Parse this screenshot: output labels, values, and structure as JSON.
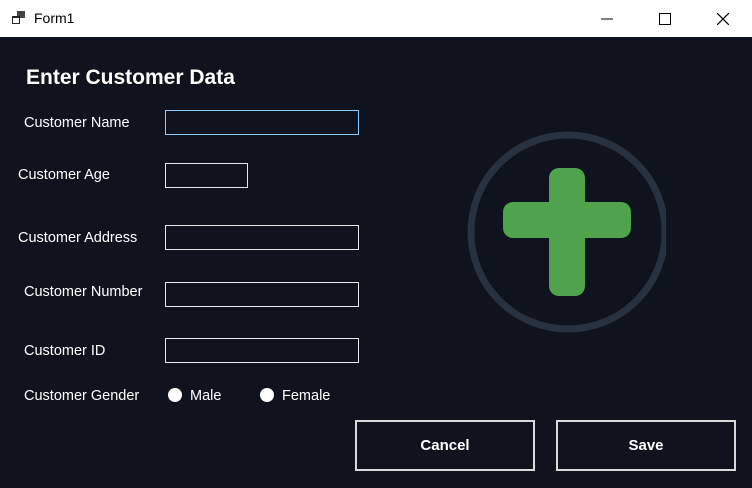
{
  "window": {
    "title": "Form1",
    "icons": {
      "app": "app-icon",
      "minimize": "minimize-icon",
      "maximize": "maximize-icon",
      "close": "close-icon"
    }
  },
  "form": {
    "heading": "Enter Customer Data",
    "fields": {
      "name": {
        "label": "Customer Name",
        "value": ""
      },
      "age": {
        "label": "Customer Age",
        "value": ""
      },
      "address": {
        "label": "Customer Address",
        "value": ""
      },
      "number": {
        "label": "Customer Number",
        "value": ""
      },
      "id": {
        "label": "Customer ID",
        "value": ""
      }
    },
    "gender": {
      "label": "Customer Gender",
      "options": [
        "Male",
        "Female"
      ],
      "selected": null
    },
    "buttons": {
      "cancel": "Cancel",
      "save": "Save"
    },
    "illustration": {
      "icon": "add-plus-icon",
      "ring_color": "#27313f",
      "plus_color": "#4ea34c"
    }
  }
}
